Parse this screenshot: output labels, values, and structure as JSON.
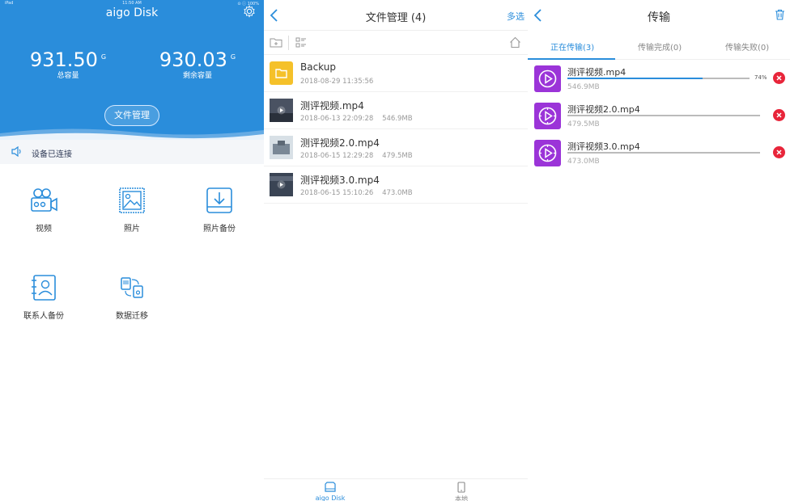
{
  "panel1": {
    "status": {
      "left": "iPad",
      "time": "11:50 AM",
      "right": "⊙ ⓘ 100%"
    },
    "app_title": "aigo Disk",
    "total": {
      "value": "931.50",
      "unit": "G",
      "label": "总容量"
    },
    "free": {
      "value": "930.03",
      "unit": "G",
      "label": "剩余容量"
    },
    "file_mgmt_button": "文件管理",
    "connection": "设备已连接",
    "grid": [
      {
        "label": "视频",
        "icon": "video-camera-icon"
      },
      {
        "label": "照片",
        "icon": "photo-icon"
      },
      {
        "label": "照片备份",
        "icon": "download-backup-icon"
      },
      {
        "label": "联系人备份",
        "icon": "contacts-icon"
      },
      {
        "label": "数据迁移",
        "icon": "data-migration-icon"
      }
    ]
  },
  "panel2": {
    "title": "文件管理 (4)",
    "select_all": "多选",
    "files": [
      {
        "name": "Backup",
        "date": "2018-08-29 11:35:56",
        "size": "",
        "type": "folder"
      },
      {
        "name": "测评视频.mp4",
        "date": "2018-06-13 22:09:28",
        "size": "546.9MB",
        "type": "video"
      },
      {
        "name": "测评视频2.0.mp4",
        "date": "2018-06-15 12:29:28",
        "size": "479.5MB",
        "type": "image"
      },
      {
        "name": "测评视频3.0.mp4",
        "date": "2018-06-15 15:10:26",
        "size": "473.0MB",
        "type": "video"
      }
    ],
    "bottom_tabs": [
      {
        "label": "aigo Disk",
        "active": true
      },
      {
        "label": "本地",
        "active": false
      }
    ]
  },
  "panel3": {
    "title": "传输",
    "tabs": [
      {
        "label": "正在传输(3)",
        "active": true
      },
      {
        "label": "传输完成(0)",
        "active": false
      },
      {
        "label": "传输失败(0)",
        "active": false
      }
    ],
    "transfers": [
      {
        "name": "测评视频.mp4",
        "size": "546.9MB",
        "progress": 0.74,
        "percent_label": "74%"
      },
      {
        "name": "测评视频2.0.mp4",
        "size": "479.5MB",
        "progress": 0.0,
        "percent_label": ""
      },
      {
        "name": "测评视频3.0.mp4",
        "size": "473.0MB",
        "progress": 0.0,
        "percent_label": ""
      }
    ]
  },
  "colors": {
    "accent": "#2a8ddb",
    "folder": "#f5c12a",
    "transfer_icon": "#9b34d8",
    "cancel": "#e8253a"
  }
}
